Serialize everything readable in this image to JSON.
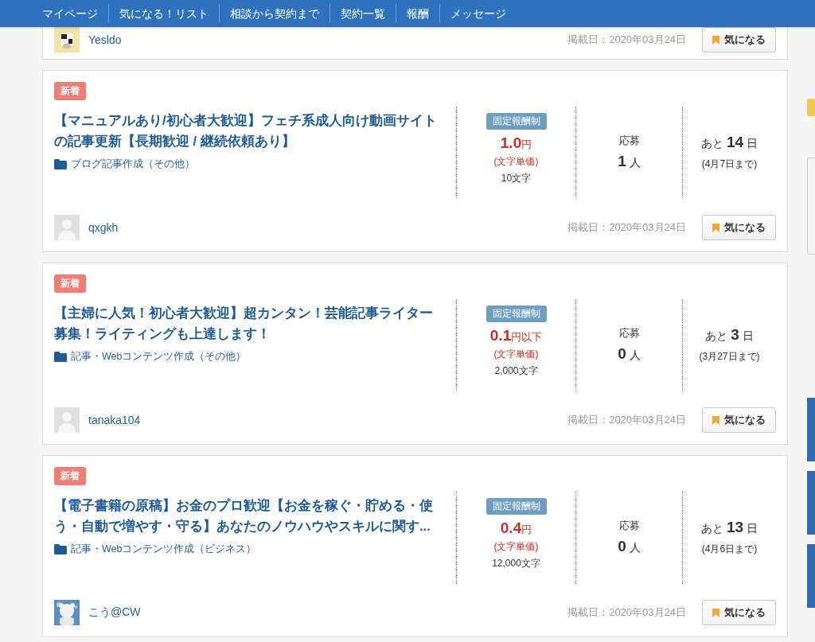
{
  "nav": {
    "items": [
      "マイページ",
      "気になる！リスト",
      "相談から契約まで",
      "契約一覧",
      "報酬",
      "メッセージ"
    ]
  },
  "jobs": [
    {
      "kind": "footer_only",
      "user": {
        "name": "Yesldo",
        "kind": "picture"
      },
      "posted": "掲載日：2020年03月24日",
      "button": "気になる"
    },
    {
      "kind": "full",
      "badge": "新着",
      "title": "【マニュアルあり/初心者大歓迎】フェチ系成人向け動画サイトの記事更新【長期歓迎 / 継続依頼あり】",
      "category": "ブログ記事作成（その他）",
      "price_type": "固定報酬制",
      "price": "1.0",
      "price_unit": "円",
      "price_note": "(文字単価)",
      "word_count": "10文字",
      "applicants_label": "応募",
      "applicants": "1",
      "applicants_unit": "人",
      "remaining_prefix": "あと",
      "days": "14",
      "days_unit": "日",
      "deadline": "(4月7日まで)",
      "user": {
        "name": "qxgkh",
        "kind": "placeholder"
      },
      "posted": "掲載日：2020年03月24日",
      "button": "気になる"
    },
    {
      "kind": "full",
      "badge": "新着",
      "title": "【主婦に人気！初心者大歓迎】超カンタン！芸能記事ライター募集！ライティングも上達します！",
      "category": "記事・Webコンテンツ作成（その他）",
      "price_type": "固定報酬制",
      "price": "0.1",
      "price_unit": "円以下",
      "price_note": "(文字単価)",
      "word_count": "2,000文字",
      "applicants_label": "応募",
      "applicants": "0",
      "applicants_unit": "人",
      "remaining_prefix": "あと",
      "days": "3",
      "days_unit": "日",
      "deadline": "(3月27日まで)",
      "user": {
        "name": "tanaka104",
        "kind": "placeholder"
      },
      "posted": "掲載日：2020年03月24日",
      "button": "気になる"
    },
    {
      "kind": "full",
      "badge": "新着",
      "title": "【電子書籍の原稿】お金のプロ歓迎【お金を稼ぐ・貯める・使う・自動で増やす・守る】あなたのノウハウやスキルに関す...",
      "category": "記事・Webコンテンツ作成（ビジネス）",
      "price_type": "固定報酬制",
      "price": "0.4",
      "price_unit": "円",
      "price_note": "(文字単価)",
      "word_count": "12,000文字",
      "applicants_label": "応募",
      "applicants": "0",
      "applicants_unit": "人",
      "remaining_prefix": "あと",
      "days": "13",
      "days_unit": "日",
      "deadline": "(4月6日まで)",
      "user": {
        "name": "こう@CW",
        "kind": "picture"
      },
      "posted": "掲載日：2020年03月24日",
      "button": "気になる"
    }
  ]
}
